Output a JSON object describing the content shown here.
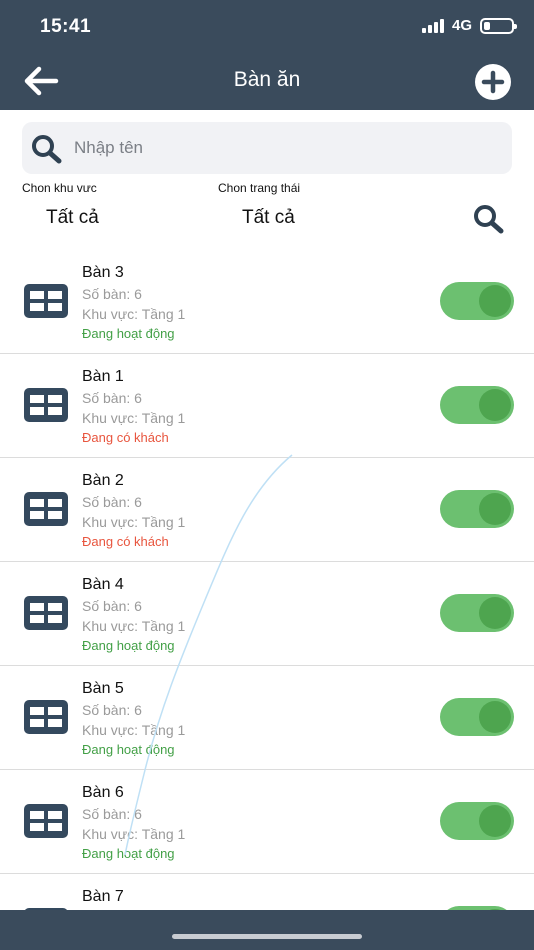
{
  "status_bar": {
    "time": "15:41",
    "network": "4G"
  },
  "header": {
    "title": "Bàn ăn"
  },
  "search": {
    "placeholder": "Nhập tên"
  },
  "filters": {
    "area_label": "Chon khu vưc",
    "area_value": "Tất cả",
    "status_label": "Chon trang thái",
    "status_value": "Tất cả"
  },
  "colors": {
    "header": "#3a4b5c",
    "active_status": "#43a047",
    "busy_status": "#e8553e",
    "toggle_on": "#6cc070"
  },
  "tables": [
    {
      "name": "Bàn 3",
      "seats": "Số bàn: 6",
      "area": "Khu vực: Tầng 1",
      "status": "Đang hoạt động",
      "status_type": "active"
    },
    {
      "name": "Bàn 1",
      "seats": "Số bàn: 6",
      "area": "Khu vực: Tầng 1",
      "status": "Đang có khách",
      "status_type": "busy"
    },
    {
      "name": "Bàn 2",
      "seats": "Số bàn: 6",
      "area": "Khu vực: Tầng 1",
      "status": "Đang có khách",
      "status_type": "busy"
    },
    {
      "name": "Bàn 4",
      "seats": "Số bàn: 6",
      "area": "Khu vực: Tầng 1",
      "status": "Đang hoạt động",
      "status_type": "active"
    },
    {
      "name": "Bàn 5",
      "seats": "Số bàn: 6",
      "area": "Khu vực: Tầng 1",
      "status": "Đang hoạt động",
      "status_type": "active"
    },
    {
      "name": "Bàn 6",
      "seats": "Số bàn: 6",
      "area": "Khu vực: Tầng 1",
      "status": "Đang hoạt động",
      "status_type": "active"
    },
    {
      "name": "Bàn 7",
      "seats": "",
      "area": "",
      "status": "",
      "status_type": "active"
    }
  ],
  "icons": {
    "back": "arrow-left-icon",
    "add": "plus-circle-icon",
    "search": "magnifier-icon",
    "table": "table-grid-icon"
  }
}
